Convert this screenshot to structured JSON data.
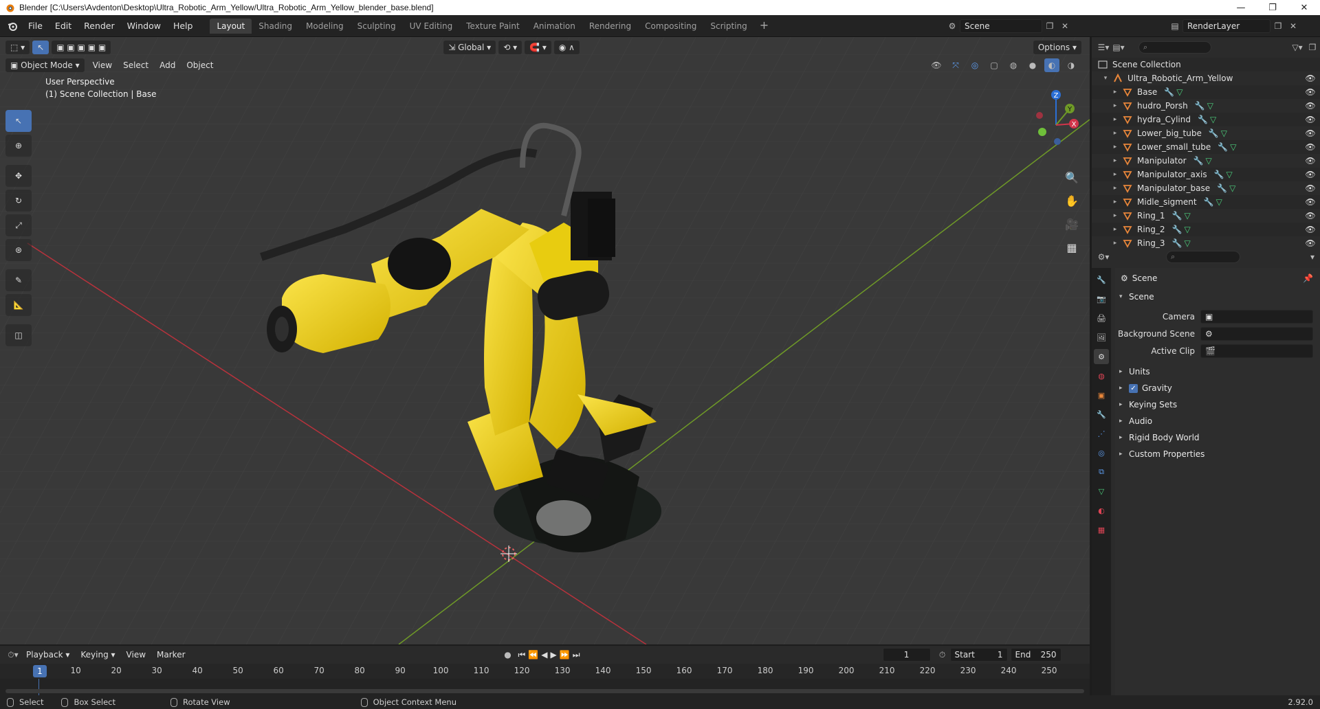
{
  "window": {
    "title": "Blender [C:\\Users\\Avdenton\\Desktop\\Ultra_Robotic_Arm_Yellow/Ultra_Robotic_Arm_Yellow_blender_base.blend]",
    "minimize": "—",
    "maximize": "❐",
    "close": "✕"
  },
  "menus": [
    "File",
    "Edit",
    "Render",
    "Window",
    "Help"
  ],
  "workspaces": [
    "Layout",
    "Shading",
    "Modeling",
    "Sculpting",
    "UV Editing",
    "Texture Paint",
    "Animation",
    "Rendering",
    "Compositing",
    "Scripting"
  ],
  "active_workspace": "Layout",
  "scene_selector": {
    "scene": "Scene",
    "view_layer": "RenderLayer"
  },
  "viewport": {
    "mode": "Object Mode",
    "menus": [
      "View",
      "Select",
      "Add",
      "Object"
    ],
    "orientation": "Global",
    "options_label": "Options",
    "info_line1": "User Perspective",
    "info_line2": "(1) Scene Collection | Base",
    "gizmo_axes": {
      "z": "Z",
      "y": "Y",
      "x": "X"
    }
  },
  "outliner": {
    "root": "Scene Collection",
    "collection": "Ultra_Robotic_Arm_Yellow",
    "objects": [
      "Base",
      "hudro_Porsh",
      "hydra_Cylind",
      "Lower_big_tube",
      "Lower_small_tube",
      "Manipulator",
      "Manipulator_axis",
      "Manipulator_base",
      "Midle_sigment",
      "Ring_1",
      "Ring_2",
      "Ring_3"
    ]
  },
  "properties": {
    "context": "Scene",
    "panel": "Scene",
    "fields": [
      {
        "label": "Camera",
        "value": ""
      },
      {
        "label": "Background Scene",
        "value": ""
      },
      {
        "label": "Active Clip",
        "value": ""
      }
    ],
    "subpanels": [
      "Units",
      "Gravity",
      "Keying Sets",
      "Audio",
      "Rigid Body World",
      "Custom Properties"
    ],
    "gravity_checked": true
  },
  "timeline": {
    "menus": [
      "Playback",
      "Keying",
      "View",
      "Marker"
    ],
    "current_frame": "1",
    "start_label": "Start",
    "start": "1",
    "end_label": "End",
    "end": "250",
    "ruler_marks": [
      "1",
      "10",
      "20",
      "30",
      "40",
      "50",
      "60",
      "70",
      "80",
      "90",
      "100",
      "110",
      "120",
      "130",
      "140",
      "150",
      "160",
      "170",
      "180",
      "190",
      "200",
      "210",
      "220",
      "230",
      "240",
      "250"
    ]
  },
  "statusbar": {
    "select": "Select",
    "box_select": "Box Select",
    "rotate_view": "Rotate View",
    "context_menu": "Object Context Menu",
    "version": "2.92.0"
  },
  "colors": {
    "accent": "#4772b3",
    "robot_yellow": "#f2d20a",
    "grid_red": "#b8323c",
    "grid_green": "#6f9a27",
    "object_orange": "#e8863a"
  }
}
